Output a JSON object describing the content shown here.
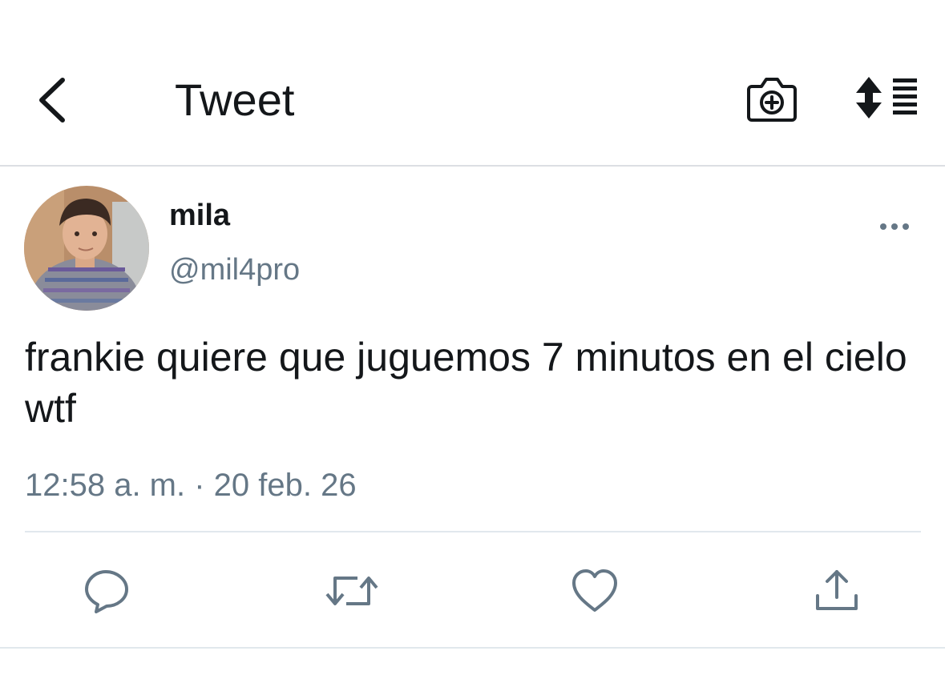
{
  "header": {
    "title": "Tweet",
    "back_icon": "chevron-left-icon",
    "camera_icon": "camera-plus-icon",
    "sort_icon": "sort-list-icon"
  },
  "tweet": {
    "display_name": "mila",
    "handle": "@mil4pro",
    "text": "frankie quiere que juguemos 7 minutos en el cielo wtf",
    "timestamp": "12:58 a. m. · 20 feb. 26",
    "more_icon": "more-dots-icon"
  },
  "actions": [
    {
      "icon": "reply-icon"
    },
    {
      "icon": "retweet-icon"
    },
    {
      "icon": "like-icon"
    },
    {
      "icon": "share-icon"
    }
  ],
  "colors": {
    "text_primary": "#14171a",
    "text_secondary": "#657786",
    "icon_action": "#657786",
    "divider": "#e1e8ed"
  }
}
